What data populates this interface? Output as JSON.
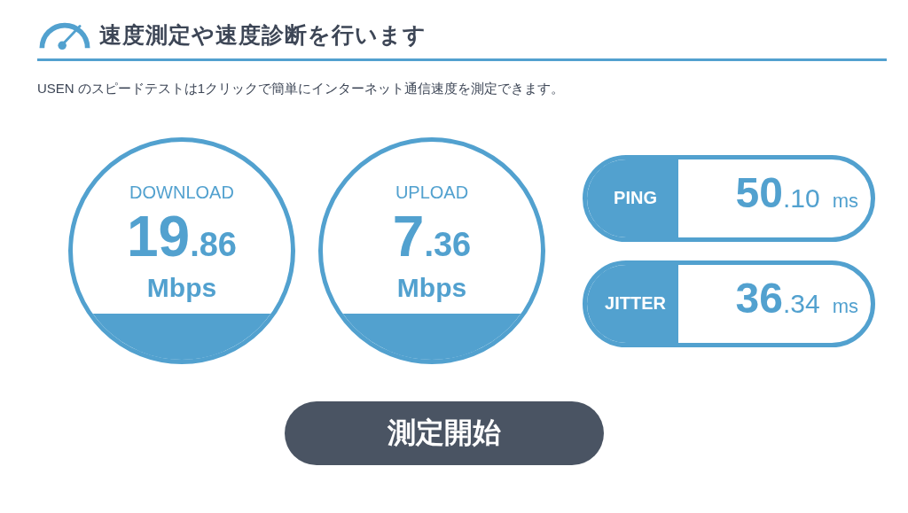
{
  "header": {
    "title": "速度測定や速度診断を行います"
  },
  "description": "USEN のスピードテストは1クリックで簡単にインターネット通信速度を測定できます。",
  "gauges": [
    {
      "label": "DOWNLOAD",
      "value": "19",
      "decimal": ".86",
      "unit": "Mbps"
    },
    {
      "label": "UPLOAD",
      "value": "7",
      "decimal": ".36",
      "unit": "Mbps"
    }
  ],
  "stats": [
    {
      "label": "PING",
      "value": "50",
      "decimal": ".10",
      "unit": "ms"
    },
    {
      "label": "JITTER",
      "value": "36",
      "decimal": ".34",
      "unit": "ms"
    }
  ],
  "start_button": "測定開始"
}
